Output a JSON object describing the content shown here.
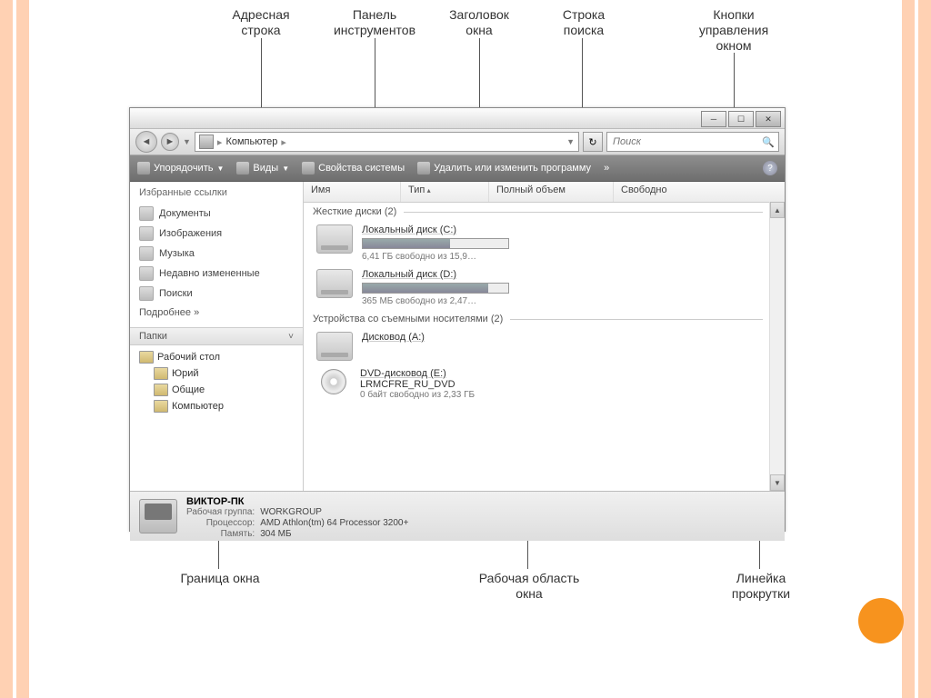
{
  "labels": {
    "address_bar": "Адресная строка",
    "toolbar": "Панель инструментов",
    "titlebar": "Заголовок окна",
    "search": "Строка поиска",
    "window_controls": "Кнопки управления окном",
    "border": "Граница окна",
    "work_area": "Рабочая область окна",
    "scrollbar": "Линейка прокрутки"
  },
  "address": {
    "root": "Компьютер",
    "arrow": "▸"
  },
  "search_placeholder": "Поиск",
  "toolbar_items": {
    "organize": "Упорядочить",
    "views": "Виды",
    "sysprops": "Свойства системы",
    "uninstall": "Удалить или изменить программу",
    "more": "»"
  },
  "sidebar": {
    "fav_title": "Избранные ссылки",
    "links": [
      "Документы",
      "Изображения",
      "Музыка",
      "Недавно измененные",
      "Поиски"
    ],
    "more": "Подробнее  »",
    "folders_title": "Папки",
    "tree": {
      "desktop": "Рабочий стол",
      "user": "Юрий",
      "public": "Общие",
      "computer": "Компьютер"
    }
  },
  "columns": {
    "name": "Имя",
    "type": "Тип",
    "total": "Полный объем",
    "free": "Свободно"
  },
  "groups": {
    "hdd": "Жесткие диски (2)",
    "removable": "Устройства со съемными носителями (2)"
  },
  "drives": {
    "c": {
      "name": "Локальный диск (C:)",
      "free": "6,41 ГБ свободно из 15,9…",
      "fill": 60
    },
    "d": {
      "name": "Локальный диск (D:)",
      "free": "365 МБ свободно из 2,47…",
      "fill": 86
    },
    "a": {
      "name": "Дисковод (A:)"
    },
    "e": {
      "name": "DVD-дисковод (E:)",
      "label": "LRMCFRE_RU_DVD",
      "free": "0 байт свободно из 2,33 ГБ"
    }
  },
  "status": {
    "computer_name": "ВИКТОР-ПК",
    "workgroup_k": "Рабочая группа:",
    "workgroup_v": "WORKGROUP",
    "cpu_k": "Процессор:",
    "cpu_v": "AMD Athlon(tm) 64 Processor 3200+",
    "mem_k": "Память:",
    "mem_v": "304 МБ"
  }
}
